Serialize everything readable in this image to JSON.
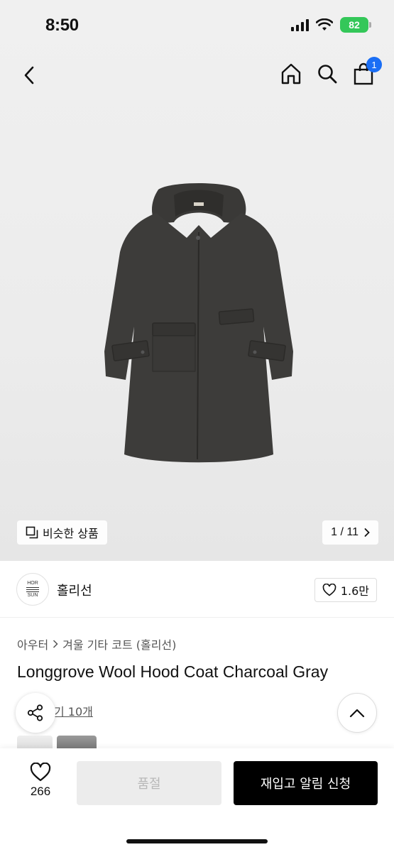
{
  "status_bar": {
    "time": "8:50",
    "battery": "82"
  },
  "cart": {
    "badge_count": "1"
  },
  "gallery": {
    "similar_label": "비슷한 상품",
    "page_indicator": "1 / 11"
  },
  "brand": {
    "logo_lines": [
      "HOR",
      "SUN"
    ],
    "name": "홀리선",
    "like_count": "1.6만"
  },
  "product": {
    "breadcrumb": [
      "아우터",
      "겨울 기타 코트 (홀리선)"
    ],
    "title": "Longgrove Wool Hood Coat Charcoal Gray",
    "review_link": "기 10개"
  },
  "bottom_bar": {
    "wish_count": "266",
    "soldout_label": "품절",
    "restock_label": "재입고 알림 신청"
  },
  "colors": {
    "accent_blue": "#1a6ef5",
    "battery_green": "#34c759",
    "coat": "#3c3b39"
  },
  "icons": [
    "chevron-left-icon",
    "home-icon",
    "search-icon",
    "shopping-bag-icon",
    "similar-items-icon",
    "chevron-right-icon",
    "heart-icon",
    "share-icon",
    "chevron-up-icon"
  ]
}
